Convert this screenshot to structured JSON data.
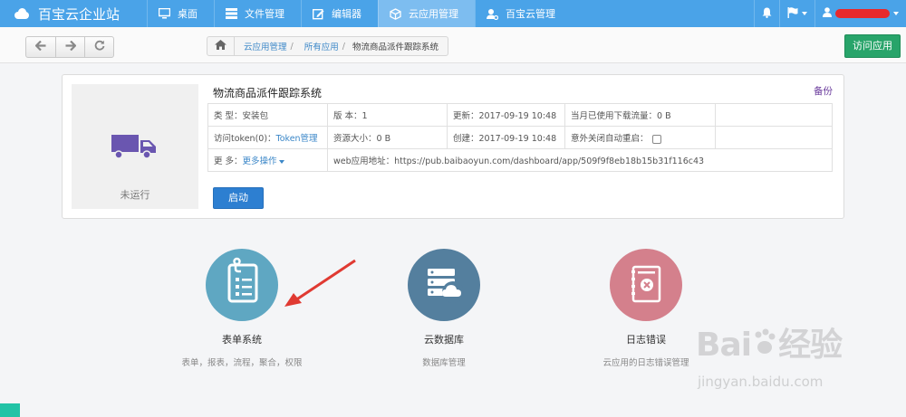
{
  "brand": {
    "title": "百宝云企业站"
  },
  "nav": {
    "items": [
      {
        "label": "桌面",
        "icon": "monitor-icon"
      },
      {
        "label": "文件管理",
        "icon": "list-icon"
      },
      {
        "label": "编辑器",
        "icon": "edit-icon"
      },
      {
        "label": "云应用管理",
        "icon": "cube-icon",
        "active": true
      },
      {
        "label": "百宝云管理",
        "icon": "user-gear-icon"
      }
    ]
  },
  "toolbar": {
    "breadcrumb": [
      "云应用管理",
      "所有应用",
      "物流商品派件跟踪系统"
    ],
    "visit_label": "访问应用"
  },
  "app": {
    "title": "物流商品派件跟踪系统",
    "backup_label": "备份",
    "status": "未运行",
    "start_label": "启动",
    "rows": {
      "type_label": "类 型：",
      "type_value": "安装包",
      "version_label": "版 本：",
      "version_value": "1",
      "updated_label": "更新：",
      "updated_value": "2017-09-19 10:48",
      "traffic_label": "当月已使用下载流量：",
      "traffic_value": "0 B",
      "token_label": "访问token(0)：",
      "token_link": "Token管理",
      "size_label": "资源大小：",
      "size_value": "0 B",
      "created_label": "创建：",
      "created_value": "2017-09-19 10:48",
      "restart_label": "意外关闭自动重启：",
      "more_label": "更 多：",
      "more_link": "更多操作",
      "url_label": "web应用地址：",
      "url_value": "https://pub.baibaoyun.com/dashboard/app/509f9f8eb18b15b31f116c43"
    }
  },
  "tiles": [
    {
      "name": "表单系统",
      "desc": "表单，报表，流程，聚合，权限",
      "color": "#5fa7c2",
      "icon": "form-clipboard-icon"
    },
    {
      "name": "云数据库",
      "desc": "数据库管理",
      "color": "#547f9e",
      "icon": "cloud-database-icon"
    },
    {
      "name": "日志错误",
      "desc": "云应用的日志错误管理",
      "color": "#d4808c",
      "icon": "error-log-icon"
    }
  ],
  "watermark": {
    "main": "Bai",
    "cn": "经验",
    "sub": "jingyan.baidu.com"
  },
  "colors": {
    "nav": "#4aa3e8",
    "accent": "#2d7fd1",
    "visit": "#28a46a"
  }
}
